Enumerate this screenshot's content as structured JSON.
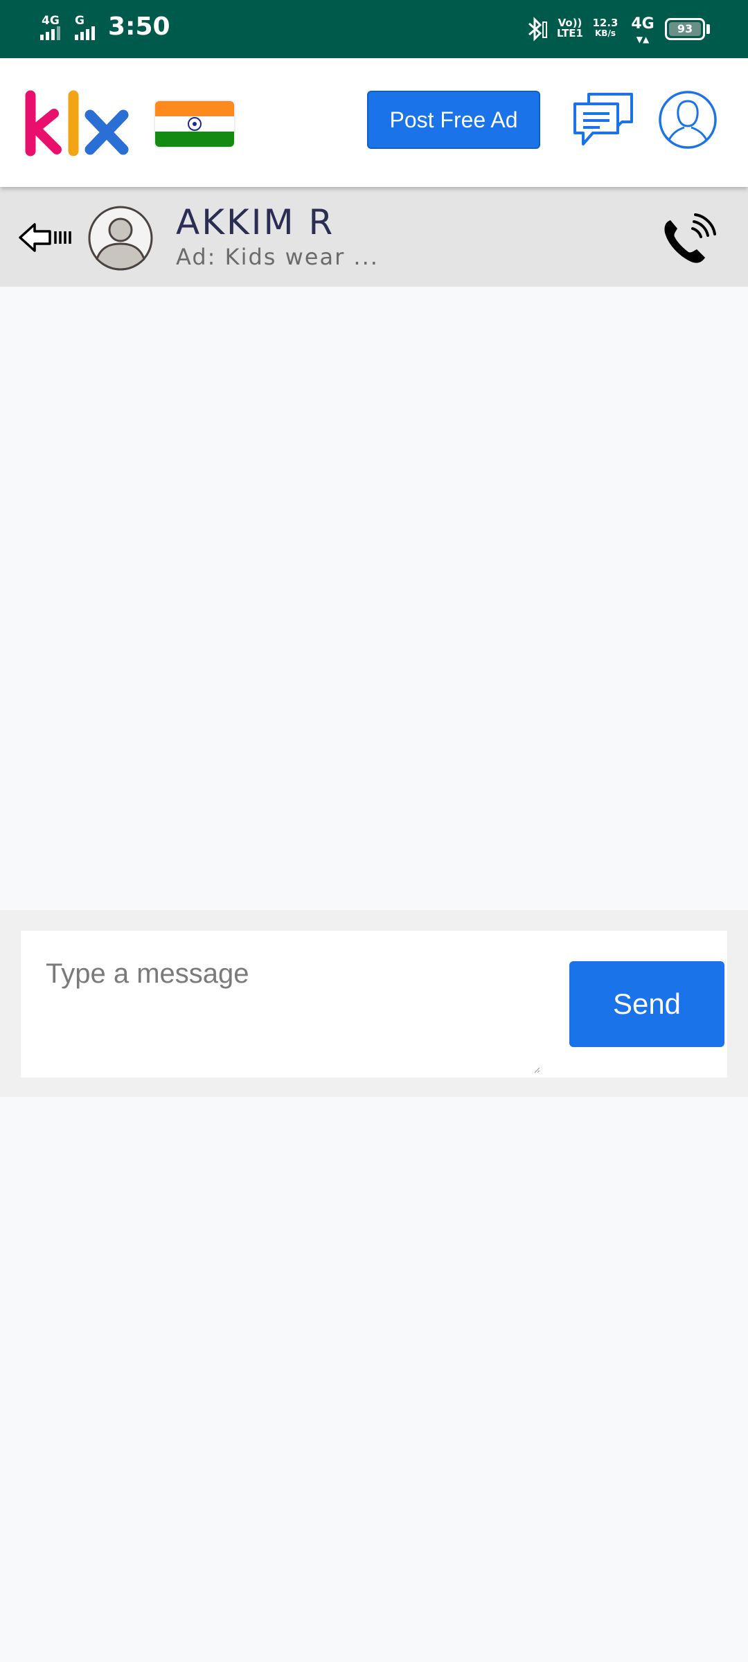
{
  "status_bar": {
    "net1": "4G",
    "net2": "G",
    "time": "3:50",
    "volte_top": "Vo))",
    "volte_bottom": "LTE1",
    "speed_value": "12.3",
    "speed_unit": "KB/s",
    "net3": "4G",
    "battery": "93"
  },
  "header": {
    "logo_text": "klx",
    "post_ad_label": "Post Free Ad",
    "colors": {
      "brand_blue": "#1a73e8",
      "logo_k": "#e8106c",
      "logo_l": "#f2a414",
      "logo_x": "#2a6fd6"
    }
  },
  "conversation": {
    "contact_name": "AKKIM R",
    "ad_title": "Ad: Kids wear ..."
  },
  "composer": {
    "placeholder": "Type a message",
    "send_label": "Send"
  },
  "icons": [
    "back-arrow-icon",
    "avatar-icon",
    "phone-call-icon",
    "chat-bubbles-icon",
    "profile-icon",
    "india-flag-icon",
    "bluetooth-icon"
  ]
}
